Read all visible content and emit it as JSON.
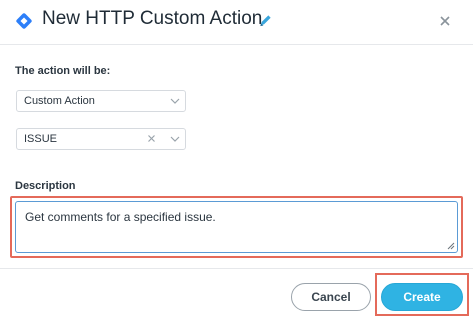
{
  "dialog": {
    "title": "New HTTP Custom Action",
    "icons": {
      "title": "diamond-action-icon",
      "edit": "pencil-icon",
      "close": "close-icon"
    }
  },
  "form": {
    "action_label": "The action will be:",
    "action_type": {
      "value": "Custom Action"
    },
    "issue_select": {
      "value": "ISSUE"
    },
    "description_label": "Description",
    "description_value": "Get comments for a specified issue."
  },
  "footer": {
    "cancel_label": "Cancel",
    "create_label": "Create"
  },
  "colors": {
    "accent": "#2fb3e3",
    "highlight": "#e46a5a",
    "title_icon": "#2d7ff9"
  }
}
